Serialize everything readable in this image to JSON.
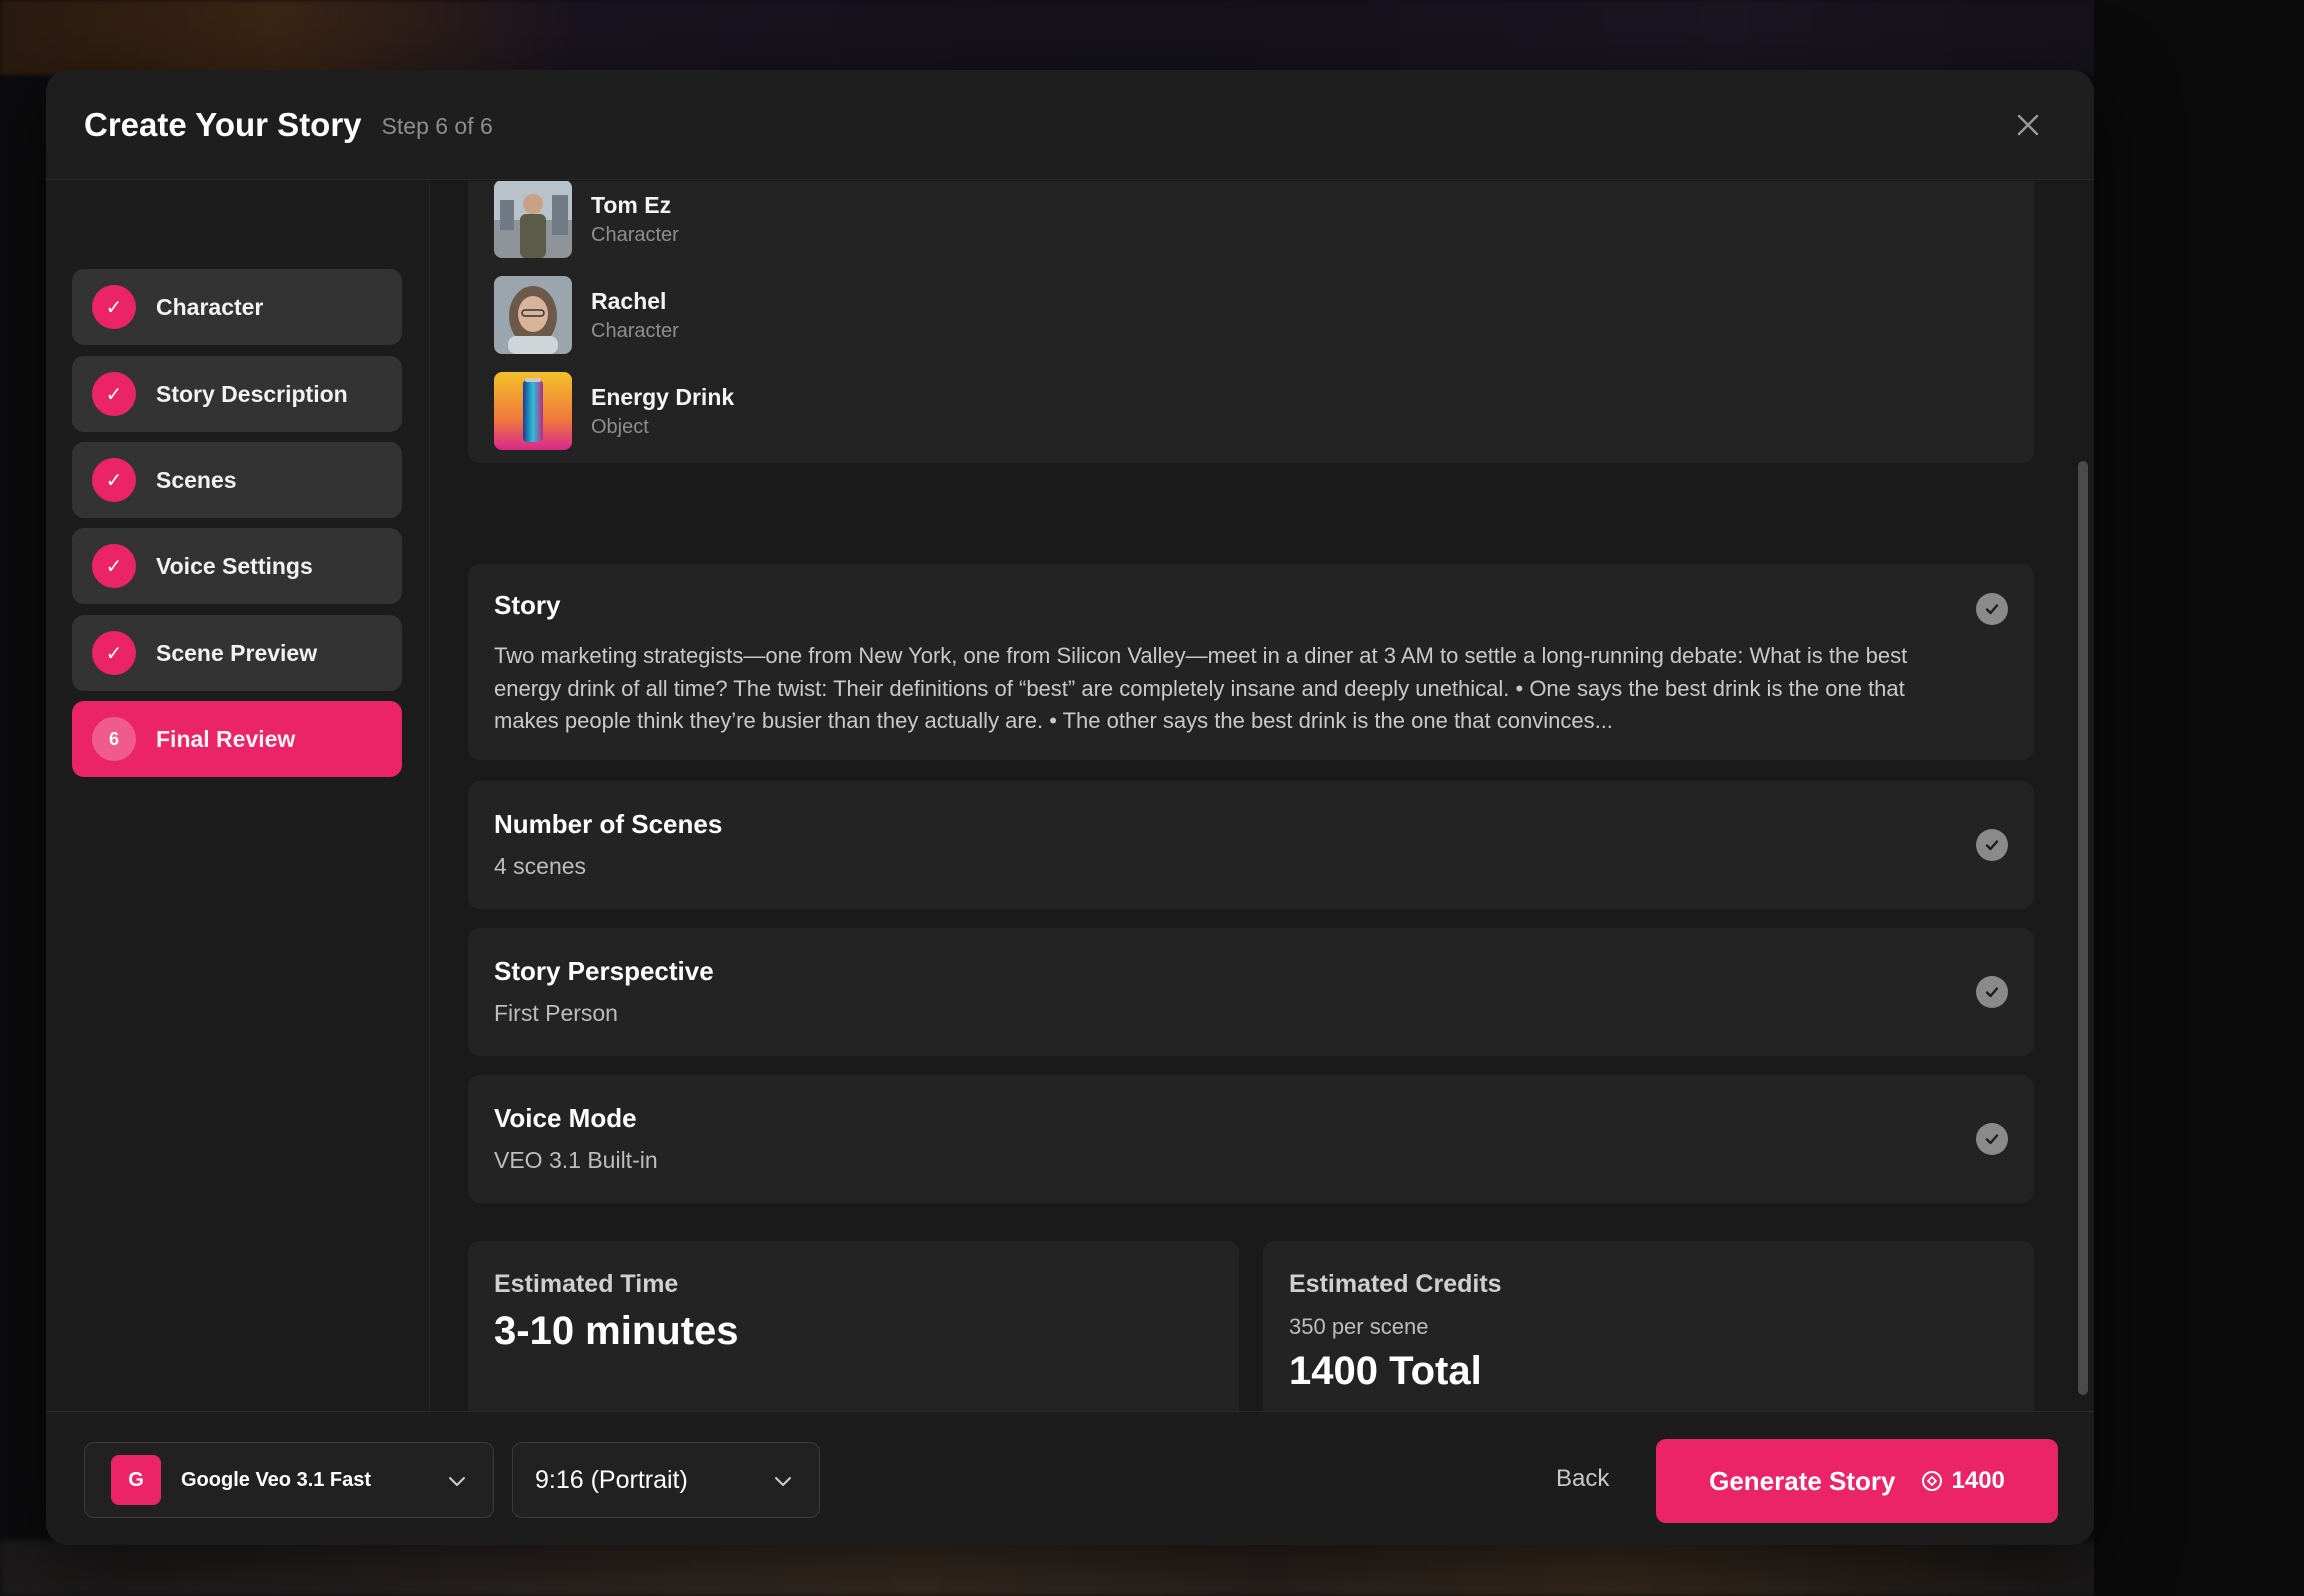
{
  "background_nav": [
    "",
    "",
    "",
    "",
    "",
    "",
    "",
    "",
    ""
  ],
  "header": {
    "title": "Create Your Story",
    "step": "Step 6 of 6"
  },
  "sidebar": {
    "items": [
      {
        "label": "Character",
        "marker": "✓"
      },
      {
        "label": "Story Description",
        "marker": "✓"
      },
      {
        "label": "Scenes",
        "marker": "✓"
      },
      {
        "label": "Voice Settings",
        "marker": "✓"
      },
      {
        "label": "Scene Preview",
        "marker": "✓"
      },
      {
        "label": "Final Review",
        "marker": "6"
      }
    ]
  },
  "assets": [
    {
      "name": "Tom Ez",
      "type": "Character"
    },
    {
      "name": "Rachel",
      "type": "Character"
    },
    {
      "name": "Energy Drink",
      "type": "Object"
    }
  ],
  "story": {
    "title": "Story",
    "text": "Two marketing strategists—one from New York, one from Silicon Valley—meet in a diner at 3 AM to settle a long-running debate: What is the best energy drink of all time? The twist: Their definitions of “best” are completely insane and deeply unethical. • One says the best drink is the one that makes people think they’re busier than they actually are. • The other says the best drink is the one that convinces..."
  },
  "scenes": {
    "title": "Number of Scenes",
    "value": "4 scenes"
  },
  "perspective": {
    "title": "Story Perspective",
    "value": "First Person"
  },
  "voice": {
    "title": "Voice Mode",
    "value": "VEO 3.1 Built-in"
  },
  "estimates": {
    "time_label": "Estimated Time",
    "time_value": "3-10 minutes",
    "credits_label": "Estimated Credits",
    "credits_per_scene": "350 per scene",
    "credits_total": "1400 Total"
  },
  "footer": {
    "model_badge": "G",
    "model": "Google Veo 3.1 Fast",
    "ratio": "9:16 (Portrait)",
    "back": "Back",
    "generate": "Generate Story",
    "generate_credits": "1400"
  },
  "colors": {
    "accent": "#ea2467",
    "card": "#232323",
    "modal": "#1a1a1a"
  }
}
